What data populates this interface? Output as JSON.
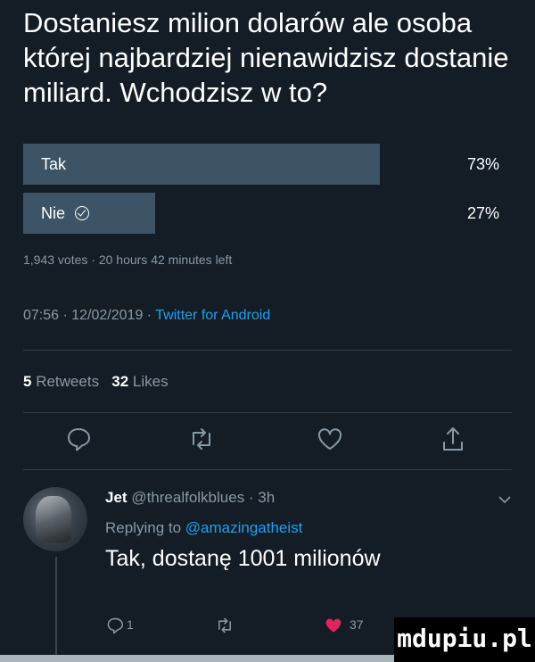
{
  "tweet": {
    "question": "Dostaniesz milion dolarów ale osoba której najbardziej nienawidzisz dostanie miliard. Wchodzisz w to?"
  },
  "poll": {
    "options": [
      {
        "label": "Tak",
        "percent": 73,
        "percent_text": "73%",
        "voted": false
      },
      {
        "label": "Nie",
        "percent": 27,
        "percent_text": "27%",
        "voted": true
      }
    ],
    "meta": "1,943 votes · 20 hours 42 minutes left"
  },
  "timestamp": {
    "time_date": "07:56 · 12/02/2019 · ",
    "source": "Twitter for Android"
  },
  "stats": {
    "retweets_count": "5",
    "retweets_label": "Retweets",
    "likes_count": "32",
    "likes_label": "Likes"
  },
  "actions": [
    "reply-icon",
    "retweet-icon",
    "heart-icon",
    "share-icon"
  ],
  "reply": {
    "name": "Jet",
    "handle_time": "@threalfolkblues · 3h",
    "replying_prefix": "Replying to ",
    "replying_to": "@amazingatheist",
    "text": "Tak, dostanę 1001 milionów",
    "reply_count": "1",
    "like_count": "37"
  },
  "colors": {
    "background": "#141d26",
    "poll_bar": "#3d5466",
    "muted": "#8899a6",
    "link": "#1da1f2",
    "like": "#e0245e"
  },
  "watermark": "mdupiu.pl"
}
